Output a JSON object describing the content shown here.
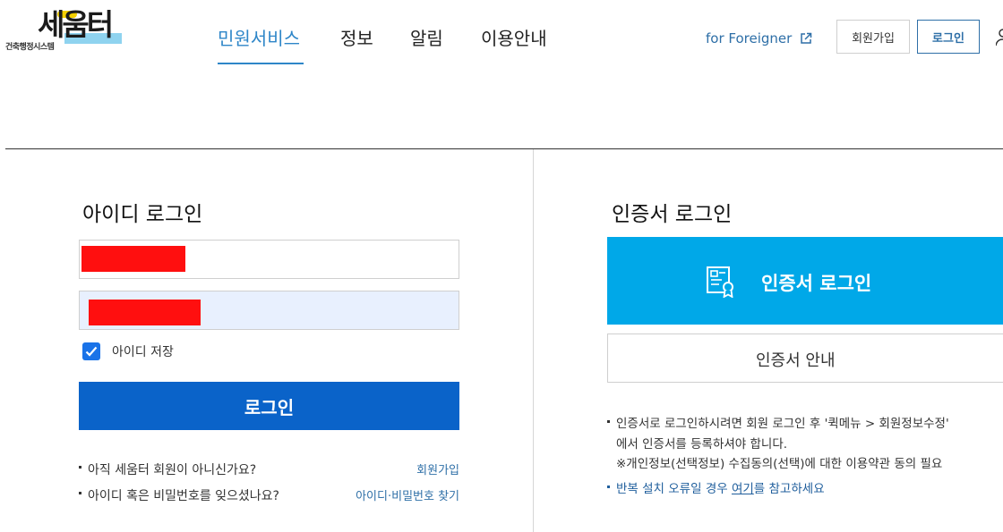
{
  "header": {
    "logo": {
      "main": "세움터",
      "sub": "건축행정시스템"
    },
    "nav": [
      {
        "label": "민원서비스",
        "active": true
      },
      {
        "label": "정보",
        "active": false
      },
      {
        "label": "알림",
        "active": false
      },
      {
        "label": "이용안내",
        "active": false
      }
    ],
    "foreigner_link": "for Foreigner",
    "join_button": "회원가입",
    "login_button": "로그인"
  },
  "id_login": {
    "title": "아이디 로그인",
    "id_value": "",
    "password_value": "",
    "remember_label": "아이디 저장",
    "remember_checked": true,
    "submit_label": "로그인",
    "help": [
      {
        "text": "아직 세움터 회원이 아니신가요?",
        "link": "회원가입"
      },
      {
        "text": "아이디 혹은 비밀번호를 잊으셨나요?",
        "link": "아이디·비밀번호 찾기"
      }
    ]
  },
  "cert_login": {
    "title": "인증서 로그인",
    "button_label": "인증서 로그인",
    "guide_label": "인증서 안내",
    "notes": {
      "line1": "인증서로 로그인하시려면 회원 로그인 후 '퀵메뉴 > 회원정보수정'",
      "line2": "에서 인증서를 등록하셔야 합니다.",
      "line3": "※개인정보(선택정보) 수집동의(선택)에 대한 이용약관 동의 필요",
      "line4_before": "반복 설치 오류일 경우 ",
      "line4_link": "여기",
      "line4_after": "를 참고하세요"
    }
  },
  "colors": {
    "accent": "#2e86c8",
    "login_button": "#0a63c9",
    "cert_button": "#00a8e8",
    "redaction": "#ff0f0f"
  }
}
